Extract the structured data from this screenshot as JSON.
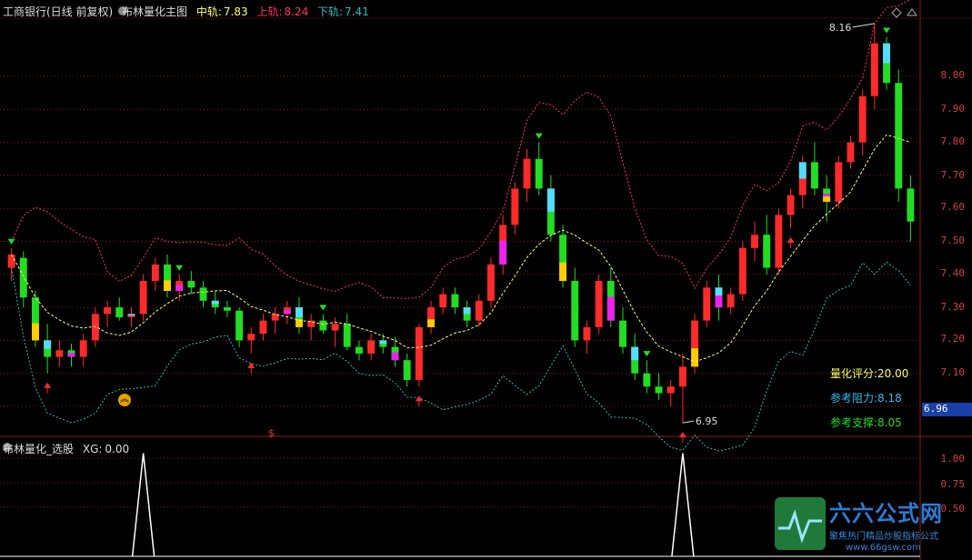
{
  "header": {
    "stock": "工商银行(日线 前复权)",
    "indicator": "布林量化主图",
    "mid_label": "中轨:",
    "mid_value": "7.83",
    "upper_label": "上轨:",
    "upper_value": "8.24",
    "lower_label": "下轨:",
    "lower_value": "7.41"
  },
  "sub_header": {
    "indicator": "布林量化_选股",
    "xg_label": "XG:",
    "xg_value": "0.00"
  },
  "price_axis": [
    "8.00",
    "7.90",
    "7.80",
    "7.70",
    "7.60",
    "7.50",
    "7.40",
    "7.30",
    "7.20",
    "7.10"
  ],
  "sub_axis": [
    "1.00",
    "0.75",
    "0.50"
  ],
  "current_price": "6.96",
  "annotations": {
    "high": "8.16",
    "low": "6.95",
    "signal": "$"
  },
  "info_panel": {
    "score_label": "量化评分:",
    "score_value": "20.00",
    "resist_label": "参考阻力:",
    "resist_value": "8.18",
    "support_label": "参考支撑:",
    "support_value": "8.05"
  },
  "watermark": {
    "title": "六六公式网",
    "subtitle": "聚焦热门精品炒股指标公式",
    "url": "www.66gsw.com"
  },
  "colors": {
    "up": "#ff2a2a",
    "down": "#22dd22",
    "mid": "#ffff66",
    "upper": "#ff3366",
    "lower": "#33bbbb",
    "grid": "#8b1a1a"
  },
  "chart_data": {
    "type": "candlestick",
    "ylim": [
      6.9,
      8.2
    ],
    "candles": [
      [
        7.42,
        7.48,
        7.38,
        7.46
      ],
      [
        7.45,
        7.47,
        7.3,
        7.33
      ],
      [
        7.33,
        7.35,
        7.18,
        7.2
      ],
      [
        7.2,
        7.25,
        7.1,
        7.15
      ],
      [
        7.15,
        7.2,
        7.12,
        7.17
      ],
      [
        7.17,
        7.19,
        7.12,
        7.15
      ],
      [
        7.15,
        7.22,
        7.12,
        7.2
      ],
      [
        7.2,
        7.3,
        7.18,
        7.28
      ],
      [
        7.28,
        7.32,
        7.24,
        7.3
      ],
      [
        7.3,
        7.33,
        7.26,
        7.27
      ],
      [
        7.27,
        7.3,
        7.24,
        7.28
      ],
      [
        7.28,
        7.4,
        7.26,
        7.38
      ],
      [
        7.38,
        7.45,
        7.35,
        7.43
      ],
      [
        7.43,
        7.46,
        7.33,
        7.35
      ],
      [
        7.35,
        7.4,
        7.32,
        7.38
      ],
      [
        7.38,
        7.41,
        7.34,
        7.36
      ],
      [
        7.36,
        7.38,
        7.3,
        7.32
      ],
      [
        7.32,
        7.35,
        7.28,
        7.3
      ],
      [
        7.3,
        7.32,
        7.27,
        7.29
      ],
      [
        7.29,
        7.3,
        7.18,
        7.2
      ],
      [
        7.2,
        7.24,
        7.16,
        7.22
      ],
      [
        7.22,
        7.28,
        7.2,
        7.26
      ],
      [
        7.26,
        7.3,
        7.22,
        7.28
      ],
      [
        7.28,
        7.32,
        7.25,
        7.3
      ],
      [
        7.3,
        7.33,
        7.22,
        7.24
      ],
      [
        7.24,
        7.28,
        7.2,
        7.26
      ],
      [
        7.26,
        7.28,
        7.22,
        7.23
      ],
      [
        7.23,
        7.27,
        7.18,
        7.25
      ],
      [
        7.25,
        7.28,
        7.17,
        7.18
      ],
      [
        7.18,
        7.2,
        7.14,
        7.16
      ],
      [
        7.16,
        7.22,
        7.14,
        7.2
      ],
      [
        7.2,
        7.22,
        7.16,
        7.18
      ],
      [
        7.18,
        7.21,
        7.12,
        7.14
      ],
      [
        7.14,
        7.16,
        7.06,
        7.08
      ],
      [
        7.08,
        7.25,
        7.06,
        7.24
      ],
      [
        7.24,
        7.32,
        7.22,
        7.3
      ],
      [
        7.3,
        7.36,
        7.28,
        7.34
      ],
      [
        7.34,
        7.36,
        7.28,
        7.3
      ],
      [
        7.3,
        7.32,
        7.24,
        7.26
      ],
      [
        7.26,
        7.34,
        7.24,
        7.32
      ],
      [
        7.32,
        7.45,
        7.3,
        7.43
      ],
      [
        7.43,
        7.58,
        7.4,
        7.55
      ],
      [
        7.55,
        7.68,
        7.52,
        7.66
      ],
      [
        7.66,
        7.78,
        7.62,
        7.75
      ],
      [
        7.75,
        7.8,
        7.64,
        7.66
      ],
      [
        7.66,
        7.7,
        7.5,
        7.52
      ],
      [
        7.52,
        7.55,
        7.36,
        7.38
      ],
      [
        7.38,
        7.42,
        7.18,
        7.2
      ],
      [
        7.2,
        7.26,
        7.16,
        7.24
      ],
      [
        7.24,
        7.4,
        7.22,
        7.38
      ],
      [
        7.38,
        7.42,
        7.24,
        7.26
      ],
      [
        7.26,
        7.3,
        7.16,
        7.18
      ],
      [
        7.18,
        7.22,
        7.08,
        7.1
      ],
      [
        7.1,
        7.14,
        7.04,
        7.06
      ],
      [
        7.06,
        7.1,
        7.02,
        7.04
      ],
      [
        7.04,
        7.08,
        7.0,
        7.06
      ],
      [
        7.06,
        7.16,
        6.95,
        7.12
      ],
      [
        7.12,
        7.28,
        7.1,
        7.26
      ],
      [
        7.26,
        7.38,
        7.24,
        7.36
      ],
      [
        7.36,
        7.4,
        7.26,
        7.3
      ],
      [
        7.3,
        7.36,
        7.28,
        7.34
      ],
      [
        7.34,
        7.5,
        7.32,
        7.48
      ],
      [
        7.48,
        7.56,
        7.44,
        7.52
      ],
      [
        7.52,
        7.58,
        7.4,
        7.42
      ],
      [
        7.42,
        7.6,
        7.4,
        7.58
      ],
      [
        7.58,
        7.66,
        7.54,
        7.64
      ],
      [
        7.64,
        7.76,
        7.6,
        7.74
      ],
      [
        7.74,
        7.8,
        7.64,
        7.66
      ],
      [
        7.66,
        7.7,
        7.56,
        7.62
      ],
      [
        7.62,
        7.76,
        7.6,
        7.74
      ],
      [
        7.74,
        7.82,
        7.72,
        7.8
      ],
      [
        7.8,
        7.96,
        7.76,
        7.94
      ],
      [
        7.94,
        8.16,
        7.9,
        8.1
      ],
      [
        8.1,
        8.12,
        7.96,
        7.98
      ],
      [
        7.98,
        8.02,
        7.62,
        7.66
      ],
      [
        7.66,
        7.7,
        7.5,
        7.56
      ]
    ],
    "xg": [
      0,
      0,
      0,
      0,
      0,
      0,
      0,
      0,
      0,
      0,
      0,
      1,
      0,
      0,
      0,
      0,
      0,
      0,
      0,
      0,
      0,
      0,
      0,
      0,
      0,
      0,
      0,
      0,
      0,
      0,
      0,
      0,
      0,
      0,
      0,
      0,
      0,
      0,
      0,
      0,
      0,
      0,
      0,
      0,
      0,
      0,
      0,
      0,
      0,
      0,
      0,
      0,
      0,
      0,
      0,
      0,
      1,
      0,
      0,
      0,
      0,
      0,
      0,
      0,
      0,
      0,
      0,
      0,
      0,
      0,
      0,
      0,
      0,
      0,
      0,
      0
    ]
  }
}
